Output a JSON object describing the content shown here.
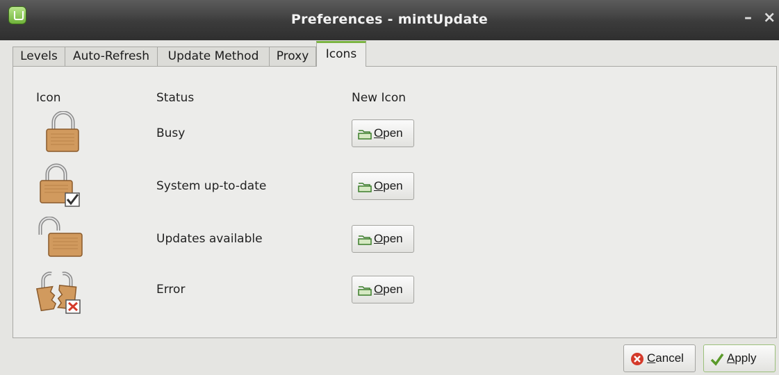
{
  "window": {
    "title": "Preferences - mintUpdate",
    "minimize_glyph": "–",
    "close_glyph": "×"
  },
  "tabs": [
    {
      "label": "Levels"
    },
    {
      "label": "Auto-Refresh"
    },
    {
      "label": "Update Method"
    },
    {
      "label": "Proxy"
    },
    {
      "label": "Icons",
      "active": true
    }
  ],
  "headers": {
    "icon": "Icon",
    "status": "Status",
    "new_icon": "New Icon"
  },
  "rows": [
    {
      "icon": "lock-busy-icon",
      "status": "Busy",
      "button_mnemonic": "O",
      "button_rest": "pen"
    },
    {
      "icon": "lock-up-to-date-icon",
      "status": "System up-to-date",
      "button_mnemonic": "O",
      "button_rest": "pen"
    },
    {
      "icon": "lock-open-updates-icon",
      "status": "Updates available",
      "button_mnemonic": "O",
      "button_rest": "pen"
    },
    {
      "icon": "lock-broken-error-icon",
      "status": "Error",
      "button_mnemonic": "O",
      "button_rest": "pen"
    }
  ],
  "buttons": {
    "cancel": {
      "mnemonic": "C",
      "rest": "ancel"
    },
    "apply": {
      "mnemonic": "A",
      "rest": "pply"
    }
  },
  "colors": {
    "title_bg": "#3b3b3b",
    "active_tab_accent": "#7ab341",
    "lock_body": "#d19a5e",
    "error_mark": "#d43a2a"
  }
}
